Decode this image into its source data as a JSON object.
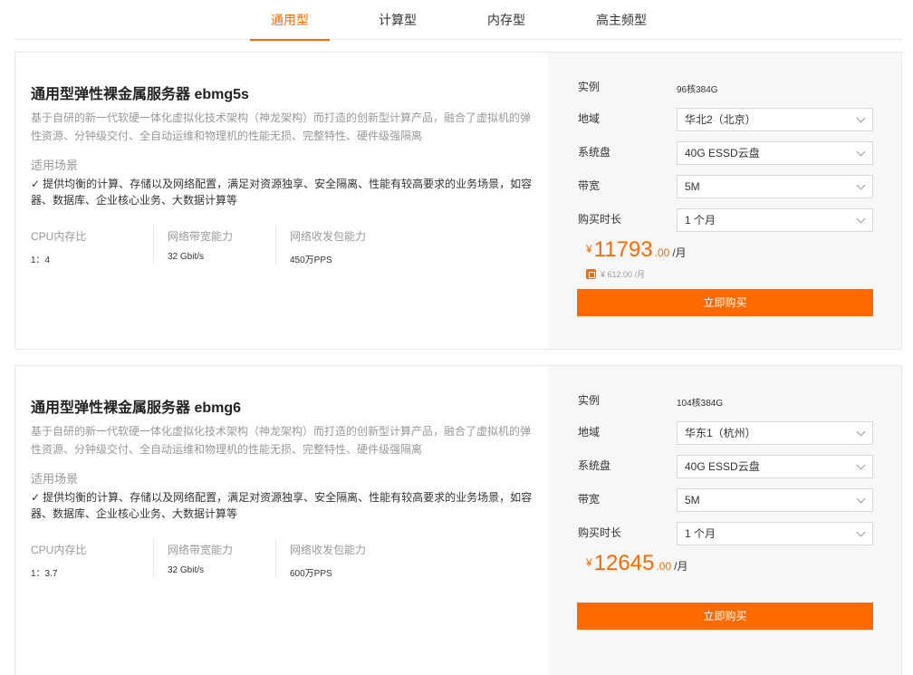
{
  "tabs": [
    {
      "label": "通用型",
      "active": true
    },
    {
      "label": "计算型",
      "active": false
    },
    {
      "label": "内存型",
      "active": false
    },
    {
      "label": "高主频型",
      "active": false
    }
  ],
  "accent_color": "#ff6a00",
  "cards": [
    {
      "title": "通用型弹性裸金属服务器 ebmg5s",
      "description": "基于自研的新一代软硬一体化虚拟化技术架构（神龙架构）而打造的创新型计算产品，融合了虚拟机的弹性资源、分钟级交付、全自动运维和物理机的性能无损、完整特性、硬件级强隔离",
      "scene_label": "适用场景",
      "scene_text": "提供均衡的计算、存储以及网络配置，满足对资源独享、安全隔离、性能有较高要求的业务场景，如容器、数据库、企业核心业务、大数据计算等",
      "specs": [
        {
          "label": "CPU内存比",
          "value": "1：4"
        },
        {
          "label": "网络带宽能力",
          "value": "32 Gbit/s"
        },
        {
          "label": "网络收发包能力",
          "value": "450万PPS"
        }
      ],
      "instance_label": "实例",
      "instance_value": "96核384G",
      "region_label": "地域",
      "region_value": "华北2（北京）",
      "disk_label": "系统盘",
      "disk_value": "40G ESSD云盘",
      "bandwidth_label": "带宽",
      "bandwidth_value": "5M",
      "duration_label": "购买时长",
      "duration_value": "1 个月",
      "price_symbol": "¥",
      "price_int": "11793",
      "price_dec": ".00",
      "price_unit": "/月",
      "original_price": "¥ 612.00 /月",
      "buy_label": "立即购买"
    },
    {
      "title": "通用型弹性裸金属服务器 ebmg6",
      "description": "基于自研的新一代软硬一体化虚拟化技术架构（神龙架构）而打造的创新型计算产品，融合了虚拟机的弹性资源、分钟级交付、全自动运维和物理机的性能无损、完整特性、硬件级强隔离",
      "scene_label": "适用场景",
      "scene_text": "提供均衡的计算、存储以及网络配置，满足对资源独享、安全隔离、性能有较高要求的业务场景，如容器、数据库、企业核心业务、大数据计算等",
      "specs": [
        {
          "label": "CPU内存比",
          "value": "1：3.7"
        },
        {
          "label": "网络带宽能力",
          "value": "32 Gbit/s"
        },
        {
          "label": "网络收发包能力",
          "value": "600万PPS"
        }
      ],
      "instance_label": "实例",
      "instance_value": "104核384G",
      "region_label": "地域",
      "region_value": "华东1（杭州）",
      "disk_label": "系统盘",
      "disk_value": "40G ESSD云盘",
      "bandwidth_label": "带宽",
      "bandwidth_value": "5M",
      "duration_label": "购买时长",
      "duration_value": "1 个月",
      "price_symbol": "¥",
      "price_int": "12645",
      "price_dec": ".00",
      "price_unit": "/月",
      "buy_label": "立即购买"
    }
  ]
}
